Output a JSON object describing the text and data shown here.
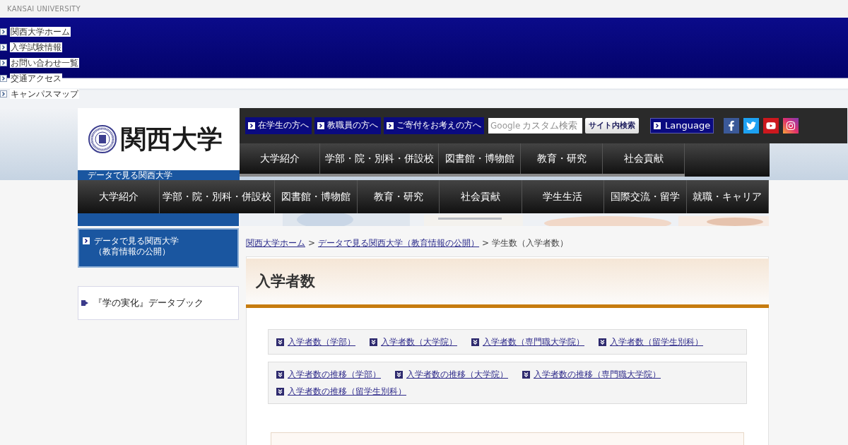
{
  "brand": "KANSAI UNIVERSITY",
  "global_links": [
    "関西大学ホーム",
    "入学試験情報",
    "お問い合わせ一覧",
    "交通アクセス",
    "キャンパスマップ"
  ],
  "logo": {
    "name": "関西大学",
    "caption": "データで見る関西大学"
  },
  "audience_links": [
    "在学生の方へ",
    "教職員の方へ",
    "ご寄付をお考えの方へ"
  ],
  "search": {
    "brand": "Google",
    "placeholder": "カスタム検索",
    "button": "サイト内検索"
  },
  "language": "Language",
  "social": [
    {
      "kind": "facebook"
    },
    {
      "kind": "twitter"
    },
    {
      "kind": "youtube"
    },
    {
      "kind": "instagram"
    }
  ],
  "nav_upper": [
    "大学紹介",
    "学部・院・別科・併設校",
    "図書館・博物館",
    "教育・研究",
    "社会貢献"
  ],
  "nav": [
    "大学紹介",
    "学部・院・別科・併設校",
    "図書館・博物館",
    "教育・研究",
    "社会貢献",
    "学生生活",
    "国際交流・留学",
    "就職・キャリア"
  ],
  "sidebar": {
    "lines": [
      "データで見る関西大学",
      "（教育情報の公開）"
    ],
    "databook": "『学の実化』データブック"
  },
  "breadcrumb": {
    "separator": ">",
    "items": [
      {
        "text": "関西大学ホーム",
        "link": true
      },
      {
        "text": "データで見る関西大学（教育情報の公開）",
        "link": true
      },
      {
        "text": "学生数（入学者数）",
        "link": false
      }
    ]
  },
  "title": "入学者数",
  "link_groups": [
    [
      "入学者数（学部）",
      "入学者数（大学院）",
      "入学者数（専門職大学院）",
      "入学者数（留学生別科）"
    ],
    [
      "入学者数の推移（学部）",
      "入学者数の推移（大学院）",
      "入学者数の推移（専門職大学院）",
      "入学者数の推移（留学生別科）"
    ]
  ]
}
